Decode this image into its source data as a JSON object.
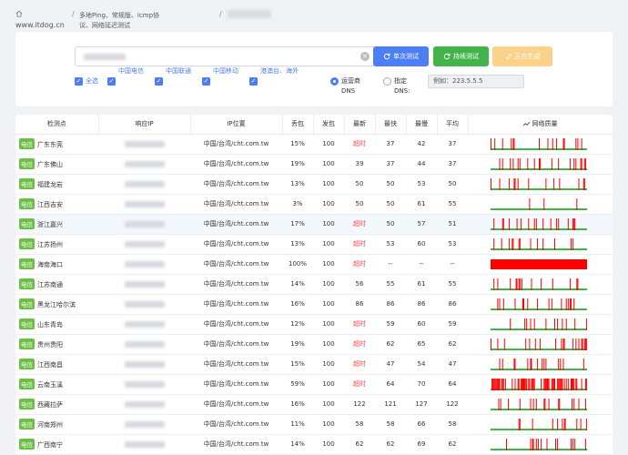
{
  "header": {
    "home_icon": "home-icon",
    "site": "www.itdog.cn",
    "crumb": "多地Ping、常规版、Icmp协议、网络延迟测试"
  },
  "form": {
    "btn_once": "单次测试",
    "btn_continuous": "持续测试",
    "btn_generating": "正在生成",
    "checkboxes": [
      "全选",
      "中国电信",
      "中国联通",
      "中国移动",
      "港澳台、海外"
    ],
    "radio_isp": "运营商 DNS",
    "radio_custom": "指定 DNS:",
    "dns_value": "例如：223.5.5.5"
  },
  "table": {
    "headers": [
      "检测点",
      "响应IP",
      "IP位置",
      "丢包",
      "发包",
      "最新",
      "最快",
      "最慢",
      "平均",
      "网络质量"
    ],
    "rows": [
      {
        "isp": "电信",
        "node": "广东东莞",
        "loc": "中国/台湾/cht.com.tw",
        "loss": "15%",
        "sent": "100",
        "latest": "超时",
        "fast": "37",
        "slow": "42",
        "avg": "37",
        "quality": 0.15,
        "hl": false
      },
      {
        "isp": "电信",
        "node": "广东佛山",
        "loc": "中国/台湾/cht.com.tw",
        "loss": "19%",
        "sent": "100",
        "latest": "39",
        "fast": "37",
        "slow": "44",
        "avg": "37",
        "quality": 0.19,
        "hl": false
      },
      {
        "isp": "电信",
        "node": "福建龙岩",
        "loc": "中国/台湾/cht.com.tw",
        "loss": "13%",
        "sent": "100",
        "latest": "50",
        "fast": "50",
        "slow": "53",
        "avg": "50",
        "quality": 0.13,
        "hl": false
      },
      {
        "isp": "电信",
        "node": "江西吉安",
        "loc": "中国/台湾/cht.com.tw",
        "loss": "3%",
        "sent": "100",
        "latest": "50",
        "fast": "50",
        "slow": "61",
        "avg": "55",
        "quality": 0.03,
        "hl": false
      },
      {
        "isp": "电信",
        "node": "浙江嘉兴",
        "loc": "中国/台湾/cht.com.tw",
        "loss": "17%",
        "sent": "100",
        "latest": "超时",
        "fast": "50",
        "slow": "57",
        "avg": "51",
        "quality": 0.17,
        "hl": true
      },
      {
        "isp": "电信",
        "node": "江苏扬州",
        "loc": "中国/台湾/cht.com.tw",
        "loss": "13%",
        "sent": "100",
        "latest": "超时",
        "fast": "53",
        "slow": "60",
        "avg": "53",
        "quality": 0.13,
        "hl": false
      },
      {
        "isp": "电信",
        "node": "海南海口",
        "loc": "中国/台湾/cht.com.tw",
        "loss": "100%",
        "sent": "100",
        "latest": "超时",
        "fast": "--",
        "slow": "--",
        "avg": "--",
        "quality": 1.0,
        "hl": false
      },
      {
        "isp": "电信",
        "node": "江苏南通",
        "loc": "中国/台湾/cht.com.tw",
        "loss": "14%",
        "sent": "100",
        "latest": "56",
        "fast": "55",
        "slow": "61",
        "avg": "55",
        "quality": 0.14,
        "hl": false
      },
      {
        "isp": "电信",
        "node": "黑龙江哈尔滨",
        "loc": "中国/台湾/cht.com.tw",
        "loss": "16%",
        "sent": "100",
        "latest": "86",
        "fast": "86",
        "slow": "86",
        "avg": "86",
        "quality": 0.16,
        "hl": false
      },
      {
        "isp": "电信",
        "node": "山东青岛",
        "loc": "中国/台湾/cht.com.tw",
        "loss": "12%",
        "sent": "100",
        "latest": "超时",
        "fast": "59",
        "slow": "60",
        "avg": "59",
        "quality": 0.12,
        "hl": false
      },
      {
        "isp": "电信",
        "node": "贵州贵阳",
        "loc": "中国/台湾/cht.com.tw",
        "loss": "19%",
        "sent": "100",
        "latest": "超时",
        "fast": "62",
        "slow": "65",
        "avg": "62",
        "quality": 0.19,
        "hl": false
      },
      {
        "isp": "电信",
        "node": "江西南昌",
        "loc": "中国/台湾/cht.com.tw",
        "loss": "15%",
        "sent": "100",
        "latest": "超时",
        "fast": "47",
        "slow": "54",
        "avg": "47",
        "quality": 0.15,
        "hl": false
      },
      {
        "isp": "电信",
        "node": "云南玉溪",
        "loc": "中国/台湾/cht.com.tw",
        "loss": "59%",
        "sent": "100",
        "latest": "超时",
        "fast": "64",
        "slow": "70",
        "avg": "64",
        "quality": 0.59,
        "hl": false
      },
      {
        "isp": "电信",
        "node": "西藏拉萨",
        "loc": "中国/台湾/cht.com.tw",
        "loss": "16%",
        "sent": "100",
        "latest": "122",
        "fast": "121",
        "slow": "127",
        "avg": "122",
        "quality": 0.16,
        "hl": false
      },
      {
        "isp": "电信",
        "node": "河南郑州",
        "loc": "中国/台湾/cht.com.tw",
        "loss": "11%",
        "sent": "100",
        "latest": "58",
        "fast": "58",
        "slow": "66",
        "avg": "58",
        "quality": 0.11,
        "hl": false
      },
      {
        "isp": "电信",
        "node": "广西南宁",
        "loc": "中国/台湾/cht.com.tw",
        "loss": "14%",
        "sent": "100",
        "latest": "62",
        "fast": "62",
        "slow": "69",
        "avg": "62",
        "quality": 0.14,
        "hl": false
      },
      {
        "isp": "电信",
        "node": "",
        "loc": "",
        "loss": "",
        "sent": "",
        "latest": "",
        "fast": "",
        "slow": "",
        "avg": "",
        "quality": 0.0,
        "hl": false
      }
    ]
  },
  "colors": {
    "accent": "#4c7ef5",
    "ok": "#42b24a",
    "loss": "#ff0000",
    "isp_badge": "#6cbe45"
  }
}
